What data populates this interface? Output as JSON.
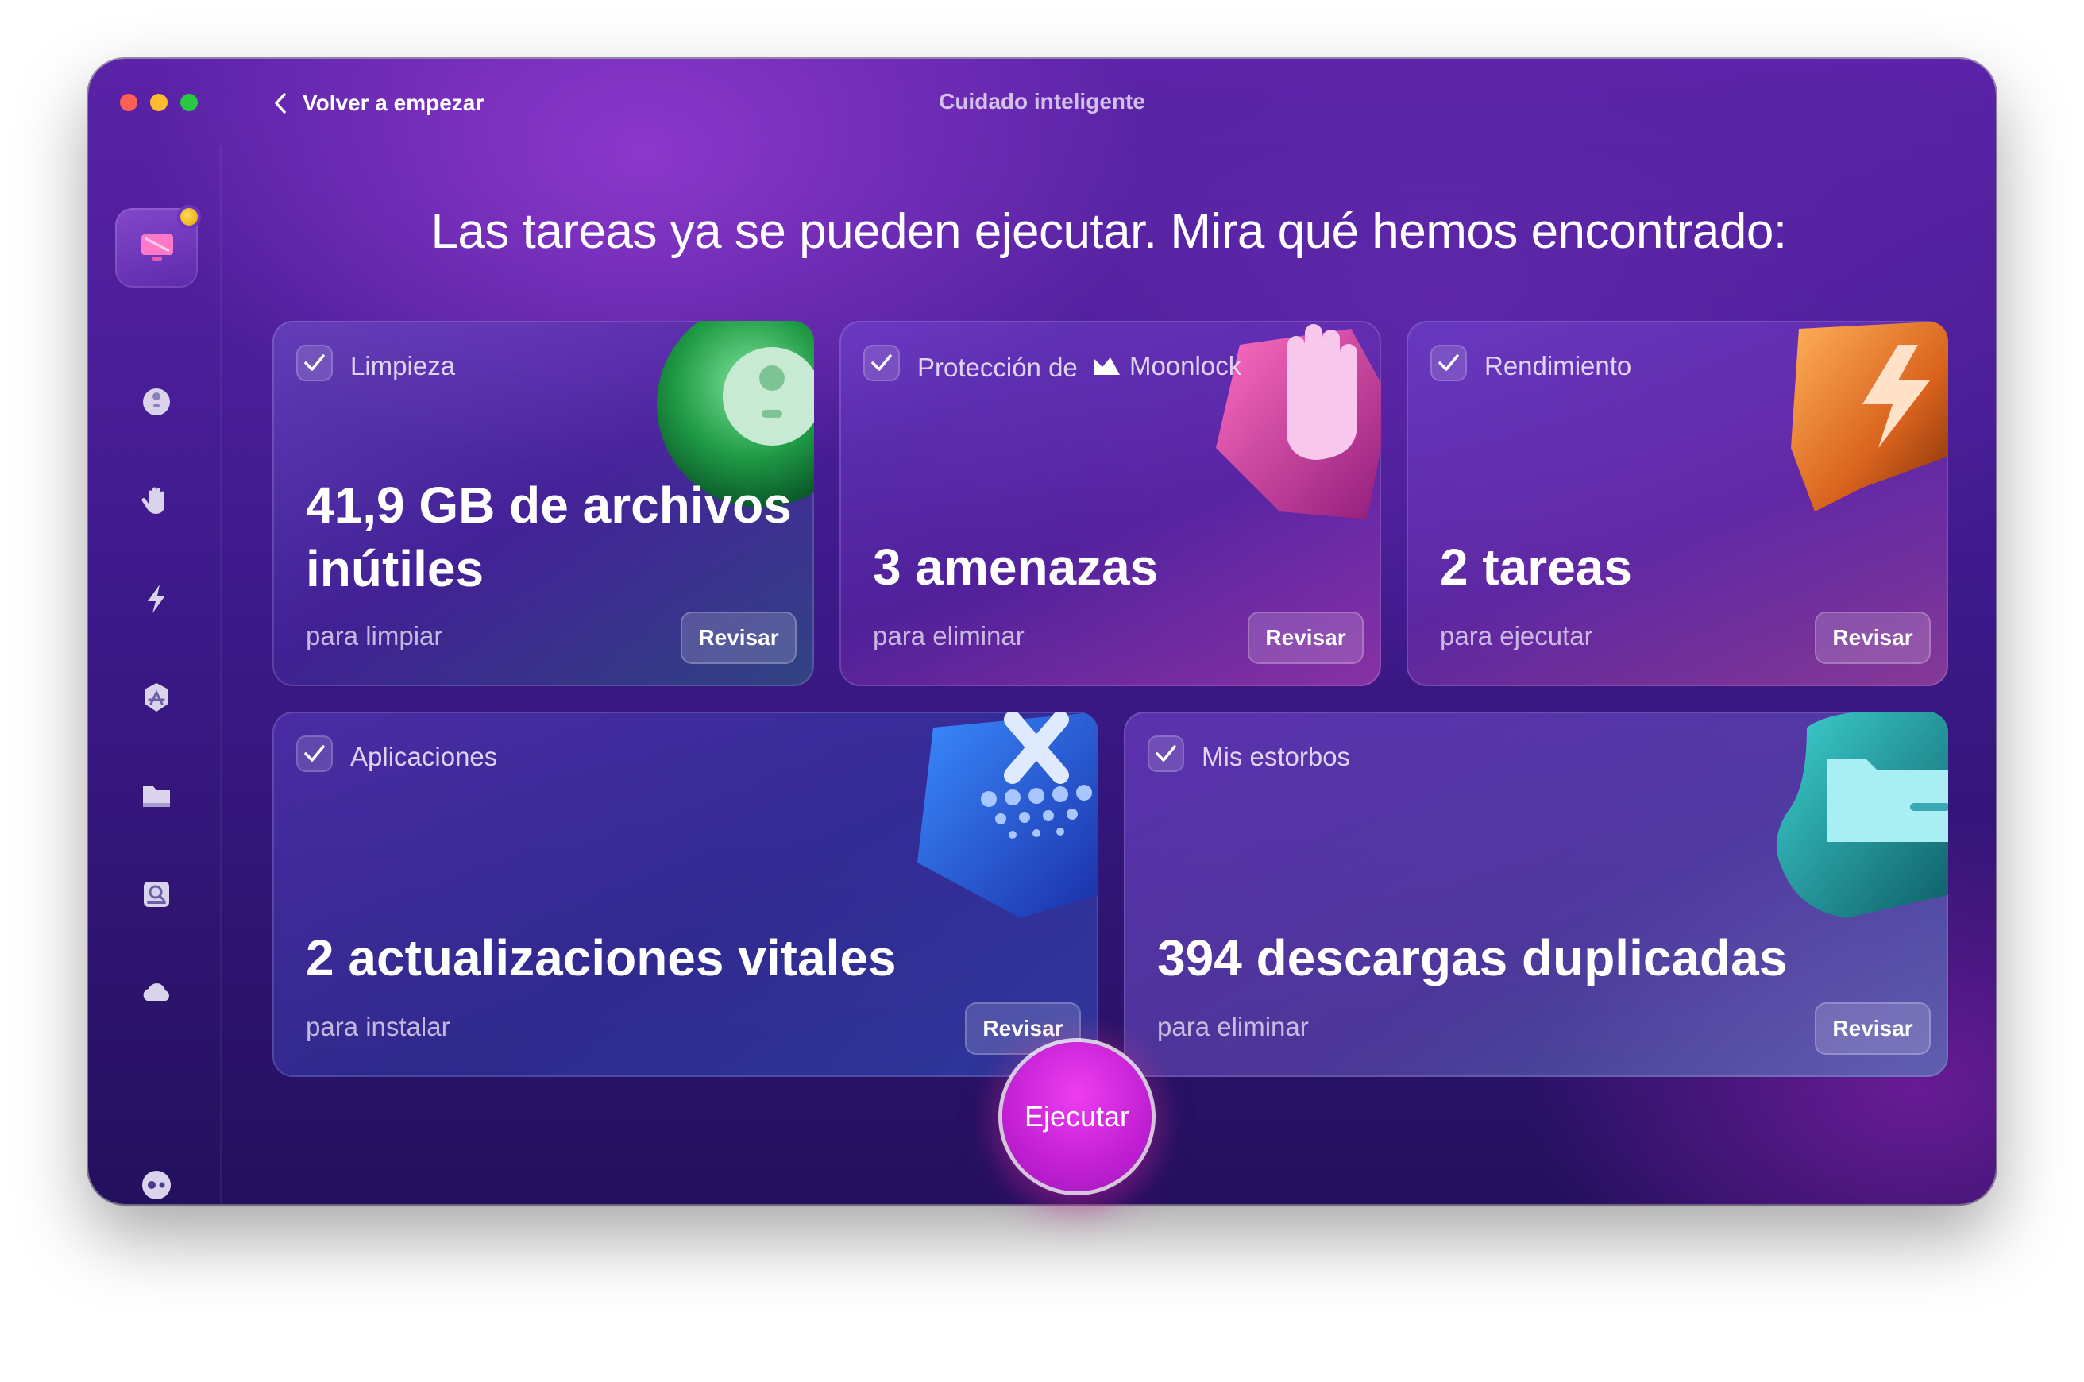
{
  "window": {
    "title": "Cuidado inteligente",
    "back_label": "Volver a empezar"
  },
  "headline": "Las tareas ya se pueden ejecutar. Mira qué hemos encontrado:",
  "sidebar": {
    "items": [
      {
        "name": "smart-care",
        "icon": "monitor-icon",
        "active": true
      },
      {
        "name": "cleanup",
        "icon": "bubble-icon"
      },
      {
        "name": "protection",
        "icon": "hand-icon"
      },
      {
        "name": "performance",
        "icon": "bolt-icon"
      },
      {
        "name": "applications",
        "icon": "app-store-icon"
      },
      {
        "name": "my-clutter",
        "icon": "folder-icon"
      },
      {
        "name": "space-lens",
        "icon": "disk-icon"
      },
      {
        "name": "cloud",
        "icon": "cloud-icon"
      },
      {
        "name": "assistant",
        "icon": "assistant-icon"
      }
    ]
  },
  "cards": [
    {
      "title": "Limpieza",
      "value": "41,9 GB de archivos inútiles",
      "value_line1": "41,9 GB de archivos",
      "value_line2": "inútiles",
      "sub": "para limpiar",
      "button": "Revisar",
      "checked": true,
      "accent": "#2fb552"
    },
    {
      "title": "Protección de",
      "brand": "Moonlock",
      "value": "3 amenazas",
      "sub": "para eliminar",
      "button": "Revisar",
      "checked": true,
      "accent": "#e03b9c"
    },
    {
      "title": "Rendimiento",
      "value": "2 tareas",
      "sub": "para ejecutar",
      "button": "Revisar",
      "checked": true,
      "accent": "#e58a2a"
    },
    {
      "title": "Aplicaciones",
      "value": "2 actualizaciones vitales",
      "sub": "para instalar",
      "button": "Revisar",
      "checked": true,
      "accent": "#1f6fe8"
    },
    {
      "title": "Mis estorbos",
      "value": "394 descargas duplicadas",
      "sub": "para eliminar",
      "button": "Revisar",
      "checked": true,
      "accent": "#22a8a8"
    }
  ],
  "run_button": "Ejecutar"
}
